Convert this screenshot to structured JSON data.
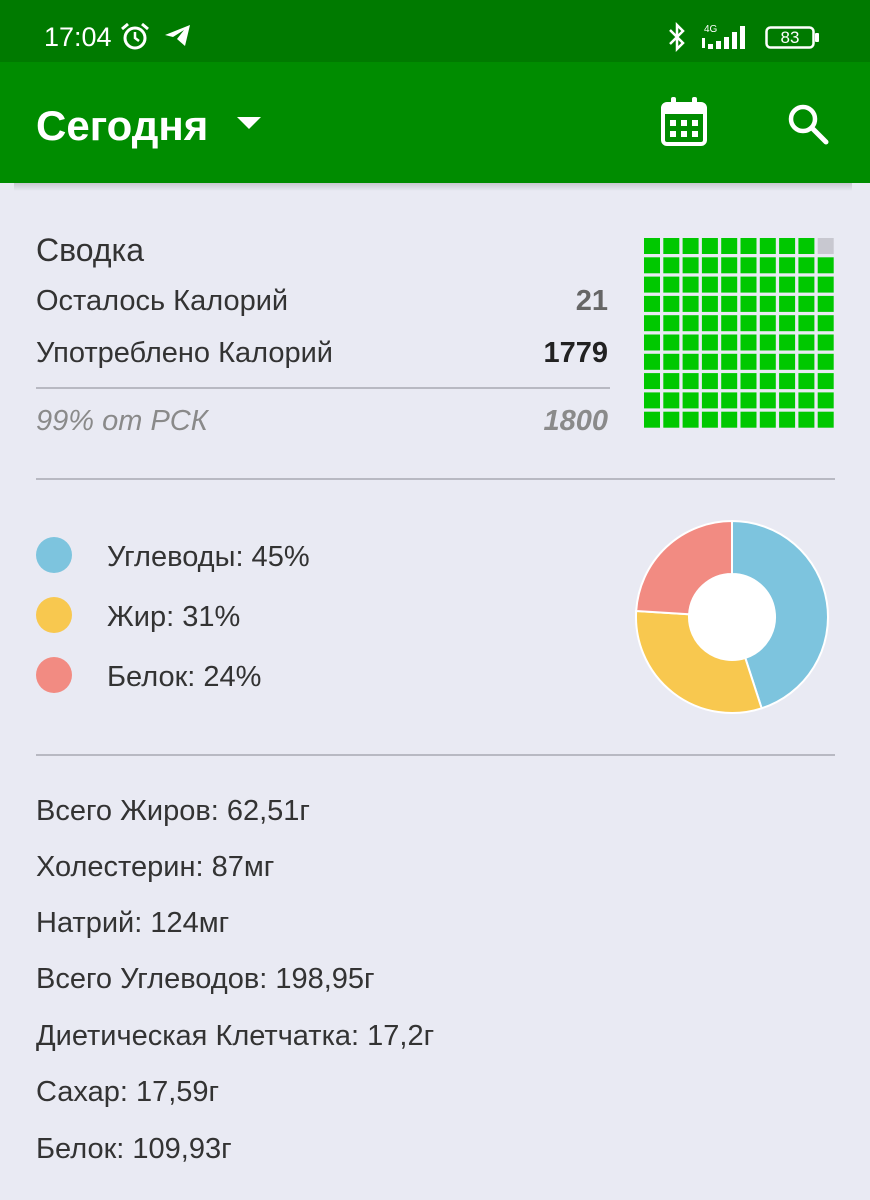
{
  "status_bar": {
    "time": "17:04",
    "network": "4G",
    "battery": "83",
    "icons": [
      "alarm-icon",
      "telegram-icon",
      "bluetooth-icon",
      "signal-icon",
      "battery-icon"
    ]
  },
  "app_bar": {
    "title": "Сегодня",
    "icons": [
      "dropdown-caret-icon",
      "calendar-icon",
      "search-icon"
    ]
  },
  "summary": {
    "title": "Сводка",
    "rows": [
      {
        "label": "Осталось Калорий",
        "value": "21"
      },
      {
        "label": "Употреблено Калорий",
        "value": "1779"
      }
    ],
    "goal_label": "99% от РСК",
    "goal_value": "1800",
    "grid_fill_fraction": 0.99
  },
  "macros": [
    {
      "label": "Углеводы: 45%",
      "percent": 45,
      "color": "#7dc4de"
    },
    {
      "label": "Жир: 31%",
      "percent": 31,
      "color": "#f8c84f"
    },
    {
      "label": "Белок: 24%",
      "percent": 24,
      "color": "#f28b82"
    }
  ],
  "nutrients": [
    "Всего Жиров: 62,51г",
    "Холестерин: 87мг",
    "Натрий: 124мг",
    "Всего Углеводов: 198,95г",
    "Диетическая Клетчатка: 17,2г",
    "Сахар: 17,59г",
    "Белок: 109,93г"
  ],
  "colors": {
    "status_bar": "#007a00",
    "app_bar": "#008c00",
    "grid_filled": "#00c800",
    "grid_empty": "#c8c8d0",
    "background": "#e9eaf3"
  }
}
